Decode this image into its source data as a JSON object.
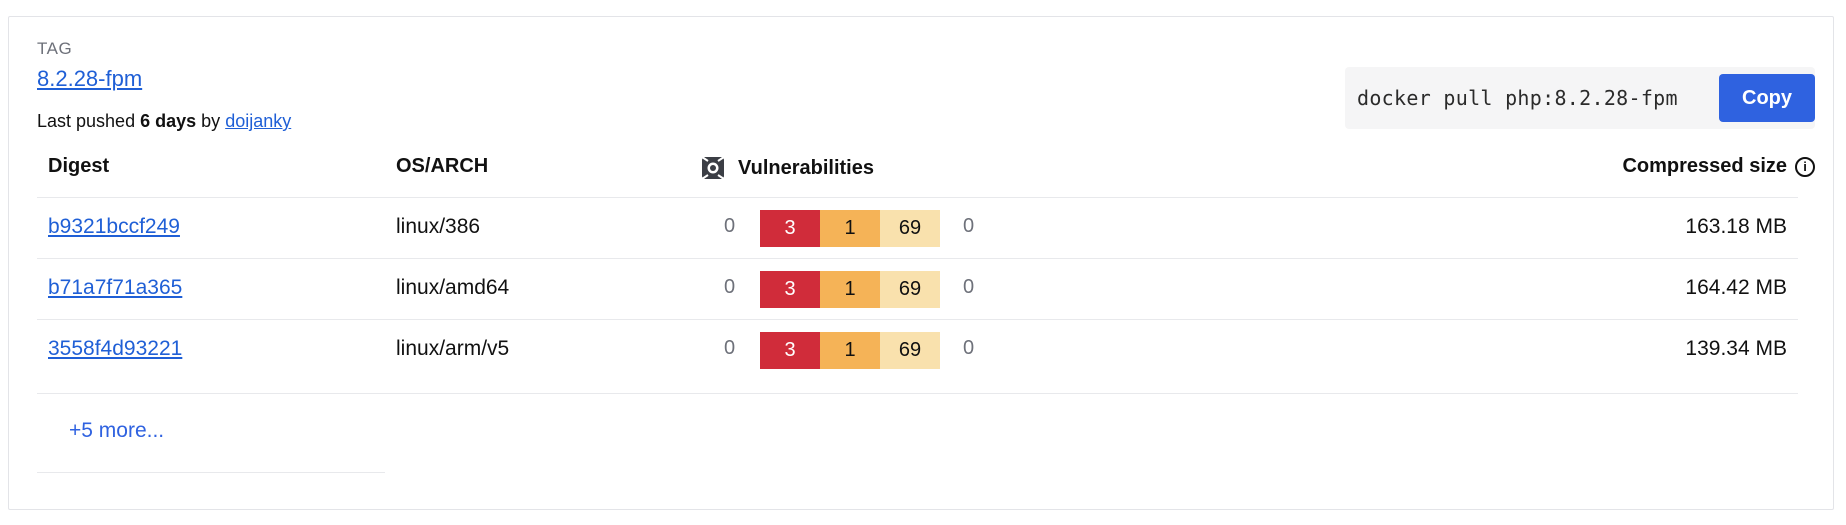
{
  "tag": {
    "label": "TAG",
    "name": "8.2.28-fpm",
    "pushed_prefix": "Last pushed",
    "pushed_age": "6 days",
    "pushed_by_word": "by",
    "pushed_by": "doijanky"
  },
  "pull": {
    "command": "docker pull php:8.2.28-fpm",
    "copy_label": "Copy"
  },
  "table": {
    "headers": {
      "digest": "Digest",
      "os_arch": "OS/ARCH",
      "vulnerabilities": "Vulnerabilities",
      "compressed_size": "Compressed size",
      "info_glyph": "i"
    },
    "rows": [
      {
        "digest": "b9321bccf249",
        "os_arch": "linux/386",
        "vuln_none_left": "0",
        "critical": "3",
        "high": "1",
        "medium": "69",
        "vuln_none_right": "0",
        "size": "163.18 MB"
      },
      {
        "digest": "b71a7f71a365",
        "os_arch": "linux/amd64",
        "vuln_none_left": "0",
        "critical": "3",
        "high": "1",
        "medium": "69",
        "vuln_none_right": "0",
        "size": "164.42 MB"
      },
      {
        "digest": "3558f4d93221",
        "os_arch": "linux/arm/v5",
        "vuln_none_left": "0",
        "critical": "3",
        "high": "1",
        "medium": "69",
        "vuln_none_right": "0",
        "size": "139.34 MB"
      }
    ],
    "more_link": "+5 more..."
  },
  "colors": {
    "link": "#1f5fd6",
    "button": "#2f62e0",
    "critical": "#d02c3a",
    "high": "#f5b357",
    "medium": "#f9e1ad"
  },
  "icons": {
    "vulnerabilities": "scout-vulnerability-icon",
    "compressed_size_info": "info-circle-icon"
  }
}
